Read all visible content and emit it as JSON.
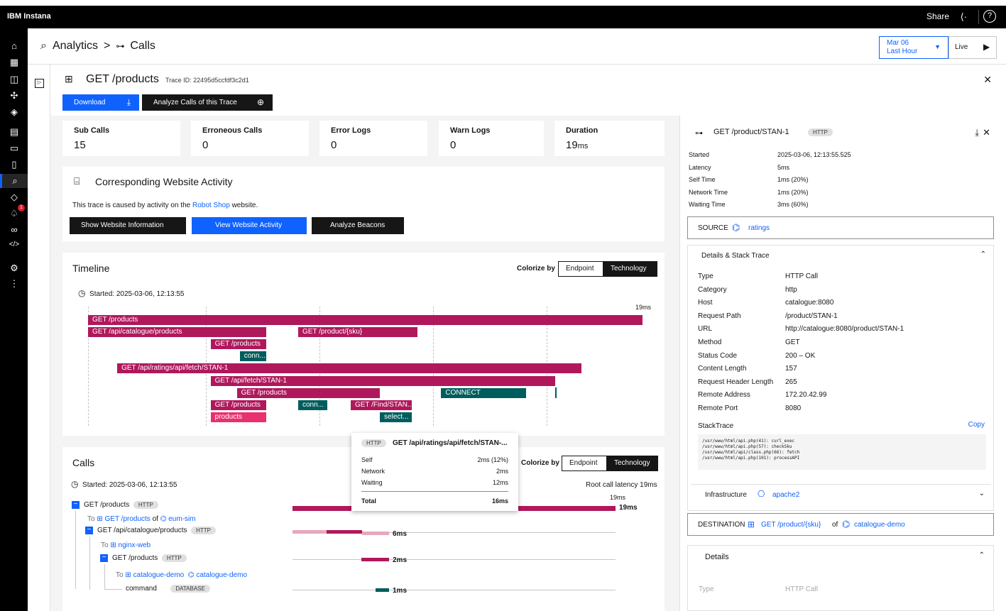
{
  "topbar": {
    "brand": "IBM Instana",
    "share_label": "Share",
    "help_icon": "?"
  },
  "sidenav": {
    "icons": [
      "home-icon",
      "dashboard-icon",
      "infrastructure-icon",
      "services-icon",
      "stack-icon",
      "applications-icon",
      "website-icon",
      "mobile-icon",
      "analytics-icon",
      "events-icon",
      "alerts-icon",
      "synthetic-icon",
      "code-icon",
      "settings-icon",
      "more-icon"
    ],
    "alert_count": "1"
  },
  "header": {
    "breadcrumb_analytics": "Analytics",
    "breadcrumb_sep": ">",
    "breadcrumb_calls": "Calls",
    "date_line1": "Mar 06",
    "date_line2": "Last Hour",
    "live_label": "Live"
  },
  "trace": {
    "title": "GET /products",
    "trace_id": "Trace ID: 22495d5ccfdf3c2d1",
    "download_label": "Download",
    "analyze_label": "Analyze Calls of this Trace"
  },
  "stats": [
    {
      "label": "Sub Calls",
      "value": "15"
    },
    {
      "label": "Erroneous Calls",
      "value": "0"
    },
    {
      "label": "Error Logs",
      "value": "0"
    },
    {
      "label": "Warn Logs",
      "value": "0"
    },
    {
      "label": "Duration",
      "value": "19",
      "unit": "ms"
    }
  ],
  "website": {
    "title": "Corresponding Website Activity",
    "text_pre": "This trace is caused by activity on the",
    "link": "Robot Shop",
    "text_post": "website.",
    "btn_show": "Show Website Information",
    "btn_view": "View Website Activity",
    "btn_analyze": "Analyze Beacons"
  },
  "timeline": {
    "title": "Timeline",
    "colorize_label": "Colorize by",
    "opt_endpoint": "Endpoint",
    "opt_technology": "Technology",
    "started": "Started: 2025-03-06, 12:13:55",
    "max_label": "19ms",
    "bars": [
      {
        "label": "GET /products",
        "start": 0,
        "end": 19,
        "row": 0,
        "color": "mag"
      },
      {
        "label": "GET /api/catalogue/products",
        "start": 0,
        "end": 6.1,
        "row": 1,
        "color": "mag"
      },
      {
        "label": "GET /product/{sku}",
        "start": 7.2,
        "end": 11.3,
        "row": 1,
        "color": "mag"
      },
      {
        "label": "GET /products",
        "start": 4.2,
        "end": 6.1,
        "row": 2,
        "color": "mag"
      },
      {
        "label": "conn...",
        "start": 5.2,
        "end": 6.1,
        "row": 3,
        "color": "teal"
      },
      {
        "label": "GET /api/ratings/api/fetch/STAN-1",
        "start": 1.0,
        "end": 16.9,
        "row": 4,
        "color": "mag"
      },
      {
        "label": "GET /api/fetch/STAN-1",
        "start": 4.2,
        "end": 16.0,
        "row": 5,
        "color": "mag"
      },
      {
        "label": "GET /products",
        "start": 5.1,
        "end": 10.0,
        "row": 6,
        "color": "mag"
      },
      {
        "label": "CONNECT",
        "start": 12.1,
        "end": 15.0,
        "row": 6,
        "color": "teal"
      },
      {
        "label": "GET /products",
        "start": 4.2,
        "end": 6.1,
        "row": 7,
        "color": "mag"
      },
      {
        "label": "conn...",
        "start": 7.2,
        "end": 8.2,
        "row": 7,
        "color": "teal"
      },
      {
        "label": "GET /Find/STAN...",
        "start": 9.0,
        "end": 11.1,
        "row": 7,
        "color": "mag"
      },
      {
        "label": "products",
        "start": 4.2,
        "end": 6.1,
        "row": 8,
        "color": "pink"
      },
      {
        "label": "select...",
        "start": 10.0,
        "end": 11.1,
        "row": 8,
        "color": "teal"
      }
    ]
  },
  "calls": {
    "title": "Calls",
    "started": "Started: 2025-03-06, 12:13:55",
    "colorize_label": "Colorize by",
    "opt_endpoint": "Endpoint",
    "opt_technology": "Technology",
    "root_latency": "Root call latency 19ms",
    "axis_max": "19ms",
    "rows": [
      {
        "name": "GET /products",
        "tag": "HTTP",
        "latency": "19ms"
      },
      {
        "to": "To",
        "endpoint": "GET /products",
        "of": "of",
        "service": "eum-sim"
      },
      {
        "name": "GET /api/catalogue/products",
        "tag": "HTTP",
        "latency": "6ms"
      },
      {
        "to": "To",
        "endpoint": "nginx-web"
      },
      {
        "name": "GET /products",
        "tag": "HTTP",
        "latency": "2ms"
      },
      {
        "to": "To",
        "endpoint": "catalogue-demo",
        "service": "catalogue-demo"
      },
      {
        "name": "command",
        "tag": "DATABASE",
        "latency": "1ms"
      }
    ]
  },
  "tooltip": {
    "tag": "HTTP",
    "title": "GET /api/ratings/api/fetch/STAN-...",
    "self_label": "Self",
    "self_val": "2ms (12%)",
    "network_label": "Network",
    "network_val": "2ms",
    "waiting_label": "Waiting",
    "waiting_val": "12ms",
    "total_label": "Total",
    "total_val": "16ms"
  },
  "right": {
    "title": "GET /product/STAN-1",
    "tag": "HTTP",
    "summary": [
      {
        "k": "Started",
        "v": "2025-03-06, 12:13:55.525"
      },
      {
        "k": "Latency",
        "v": "5ms"
      },
      {
        "k": "Self Time",
        "v": "1ms (20%)"
      },
      {
        "k": "Network Time",
        "v": "1ms (20%)"
      },
      {
        "k": "Waiting Time",
        "v": "3ms (60%)"
      }
    ],
    "source_label": "SOURCE",
    "source_val": "ratings",
    "details_title": "Details & Stack Trace",
    "details": [
      {
        "k": "Type",
        "v": "HTTP Call"
      },
      {
        "k": "Category",
        "v": "http"
      },
      {
        "k": "Host",
        "v": "catalogue:8080"
      },
      {
        "k": "Request Path",
        "v": "/product/STAN-1"
      },
      {
        "k": "URL",
        "v": "http://catalogue:8080/product/STAN-1"
      },
      {
        "k": "Method",
        "v": "GET"
      },
      {
        "k": "Status Code",
        "v": "200 – OK"
      },
      {
        "k": "Content Length",
        "v": "157"
      },
      {
        "k": "Request Header Length",
        "v": "265"
      },
      {
        "k": "Remote Address",
        "v": "172.20.42.99"
      },
      {
        "k": "Remote Port",
        "v": "8080"
      }
    ],
    "stack_label": "StackTrace",
    "copy_label": "Copy",
    "stack_lines": [
      "/usr/www/html/api.php(41): curl_exec",
      "/usr/www/html/api.php(57): checkSku",
      "/usr/www/html/api/class.php(66): fetch",
      "/usr/www/html/api.php(101): processAPI"
    ],
    "infra_label": "Infrastructure",
    "infra_val": "apache2",
    "dest_label": "DESTINATION",
    "dest_endpoint": "GET /product/{sku}",
    "dest_of": "of",
    "dest_service": "catalogue-demo",
    "details2_title": "Details",
    "details2_type_k": "Type",
    "details2_type_v": "HTTP Call"
  }
}
